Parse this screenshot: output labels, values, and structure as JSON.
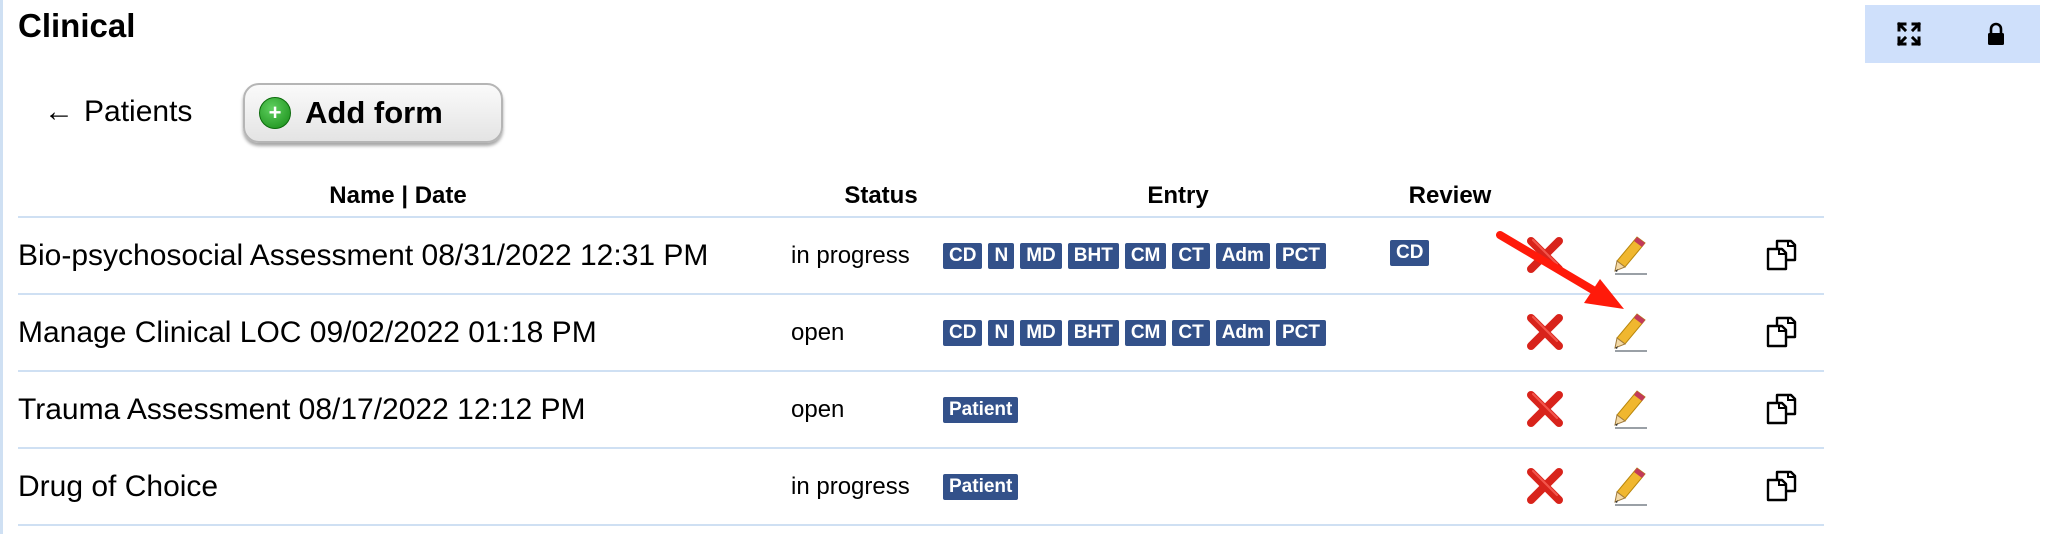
{
  "header": {
    "title": "Clinical"
  },
  "toolbar": {
    "back_label": "Patients",
    "back_arrow": "←",
    "add_form_label": "Add form"
  },
  "corner_toolbar": {
    "icons": [
      "expand-icon",
      "lock-icon"
    ]
  },
  "table": {
    "columns": {
      "name_date": "Name | Date",
      "status": "Status",
      "entry": "Entry",
      "review": "Review"
    },
    "rows": [
      {
        "name": "Bio-psychosocial Assessment 08/31/2022 12:31 PM",
        "status": "in progress",
        "entry": [
          "CD",
          "N",
          "MD",
          "BHT",
          "CM",
          "CT",
          "Adm",
          "PCT"
        ],
        "review": [
          "CD"
        ]
      },
      {
        "name": "Manage Clinical LOC 09/02/2022 01:18 PM",
        "status": "open",
        "entry": [
          "CD",
          "N",
          "MD",
          "BHT",
          "CM",
          "CT",
          "Adm",
          "PCT"
        ],
        "review": []
      },
      {
        "name": "Trauma Assessment 08/17/2022 12:12 PM",
        "status": "open",
        "entry": [
          "Patient"
        ],
        "review": []
      },
      {
        "name": "Drug of Choice",
        "status": "in progress",
        "entry": [
          "Patient"
        ],
        "review": []
      }
    ]
  },
  "colors": {
    "badge": "#33518a",
    "delete": "#d8231b",
    "pencil": "#f0b72f",
    "annotation_arrow": "#ff1a0a",
    "row_divider": "#cfe0f3"
  },
  "icons": {
    "delete": "delete-x-icon",
    "edit": "pencil-icon",
    "copy": "copy-icon",
    "add": "plus-circle-icon"
  }
}
